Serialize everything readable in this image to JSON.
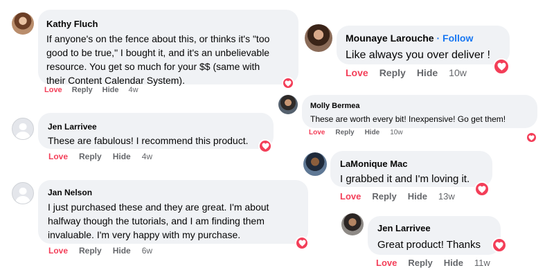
{
  "colors": {
    "bubble": "#f0f2f5",
    "love": "#f33e58",
    "action": "#65676b",
    "follow": "#1877f2",
    "text": "#050505"
  },
  "comments": [
    {
      "author": "Kathy Fluch",
      "avatar": "profile-photo",
      "lines": [
        "If anyone's on the fence about this, or thinks it's \"too",
        "good to be true,\" I bought it, and it's an unbelievable",
        "resource. You get so much for your $$ (same with",
        "their Content Calendar System)."
      ],
      "actions": {
        "love": "Love",
        "reply": "Reply",
        "hide": "Hide"
      },
      "time": "4w",
      "reaction_icon": "heart-icon"
    },
    {
      "author": "Jen Larrivee",
      "avatar": "default-avatar",
      "lines": [
        "These are fabulous! I recommend this product."
      ],
      "actions": {
        "love": "Love",
        "reply": "Reply",
        "hide": "Hide"
      },
      "time": "4w",
      "reaction_icon": "heart-icon"
    },
    {
      "author": "Jan Nelson",
      "avatar": "default-avatar",
      "lines": [
        "I just purchased these and they are great. I'm about",
        "halfway though the tutorials, and I am finding them",
        "invaluable. I'm very happy with my purchase."
      ],
      "actions": {
        "love": "Love",
        "reply": "Reply",
        "hide": "Hide"
      },
      "time": "6w",
      "reaction_icon": "heart-icon"
    },
    {
      "author": "Mounaye Larouche",
      "separator": "·",
      "follow": "Follow",
      "avatar": "profile-photo",
      "lines": [
        "Like always you over deliver !"
      ],
      "actions": {
        "love": "Love",
        "reply": "Reply",
        "hide": "Hide"
      },
      "time": "10w",
      "reaction_icon": "heart-icon"
    },
    {
      "author": "Molly Bermea",
      "avatar": "profile-photo",
      "lines": [
        "These are worth every bit! Inexpensive! Go get them!"
      ],
      "actions": {
        "love": "Love",
        "reply": "Reply",
        "hide": "Hide"
      },
      "time": "10w",
      "reaction_icon": "heart-icon"
    },
    {
      "author": "LaMonique Mac",
      "avatar": "profile-photo",
      "lines": [
        "I grabbed it and I'm loving it."
      ],
      "actions": {
        "love": "Love",
        "reply": "Reply",
        "hide": "Hide"
      },
      "time": "13w",
      "reaction_icon": "heart-icon"
    },
    {
      "author": "Jen Larrivee",
      "avatar": "profile-photo",
      "lines": [
        "Great product! Thanks"
      ],
      "actions": {
        "love": "Love",
        "reply": "Reply",
        "hide": "Hide"
      },
      "time": "11w",
      "reaction_icon": "heart-icon"
    }
  ]
}
